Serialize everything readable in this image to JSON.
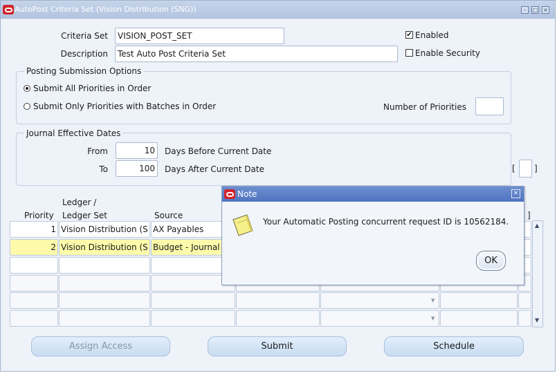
{
  "window": {
    "title": "AutoPost Criteria Set (Vision Distribution (SNG))",
    "min_glyph": "–",
    "max_glyph": "□",
    "close_glyph": "×"
  },
  "form": {
    "criteria_set_label": "Criteria Set",
    "criteria_set_value": "VISION_POST_SET",
    "description_label": "Description",
    "description_value": "Test Auto Post Criteria Set",
    "enabled_label": "Enabled",
    "enabled_checked": true,
    "enable_security_label": "Enable Security",
    "enable_security_checked": false
  },
  "posting": {
    "legend": "Posting Submission Options",
    "option_all": "Submit All Priorities in Order",
    "option_batches": "Submit Only Priorities with Batches in Order",
    "selected": "option_all",
    "num_priorities_label": "Number of Priorities",
    "num_priorities_value": ""
  },
  "dates": {
    "legend": "Journal Effective Dates",
    "from_label": "From",
    "from_value": "10",
    "from_suffix": "Days Before Current Date",
    "to_label": "To",
    "to_value": "100",
    "to_suffix": "Days After Current Date",
    "bracket_open": "[",
    "bracket_close": "]"
  },
  "table": {
    "headers": {
      "priority": "Priority",
      "ledger_line1": "Ledger /",
      "ledger_line2": "Ledger Set",
      "source": "Source"
    },
    "rows": [
      {
        "priority": "1",
        "ledger": "Vision Distribution (S",
        "source": "AX Payables"
      },
      {
        "priority": "2",
        "ledger": "Vision Distribution (S",
        "source": "Budget - Journal"
      }
    ],
    "bracket_close": "]"
  },
  "buttons": {
    "assign_access": "Assign Access",
    "submit": "Submit",
    "schedule": "Schedule"
  },
  "note_dialog": {
    "title": "Note",
    "message": "Your Automatic Posting concurrent request ID is 10562184.",
    "ok": "OK",
    "close_glyph": "×"
  },
  "icons": {
    "oracle_logo": "oracle-icon",
    "note_icon": "note-paper-icon"
  },
  "colors": {
    "titlebar": "#b3c4e0",
    "dialog_titlebar": "#4f73bf",
    "selected_row": "#fdfbab",
    "oracle_red": "#d2232a"
  }
}
